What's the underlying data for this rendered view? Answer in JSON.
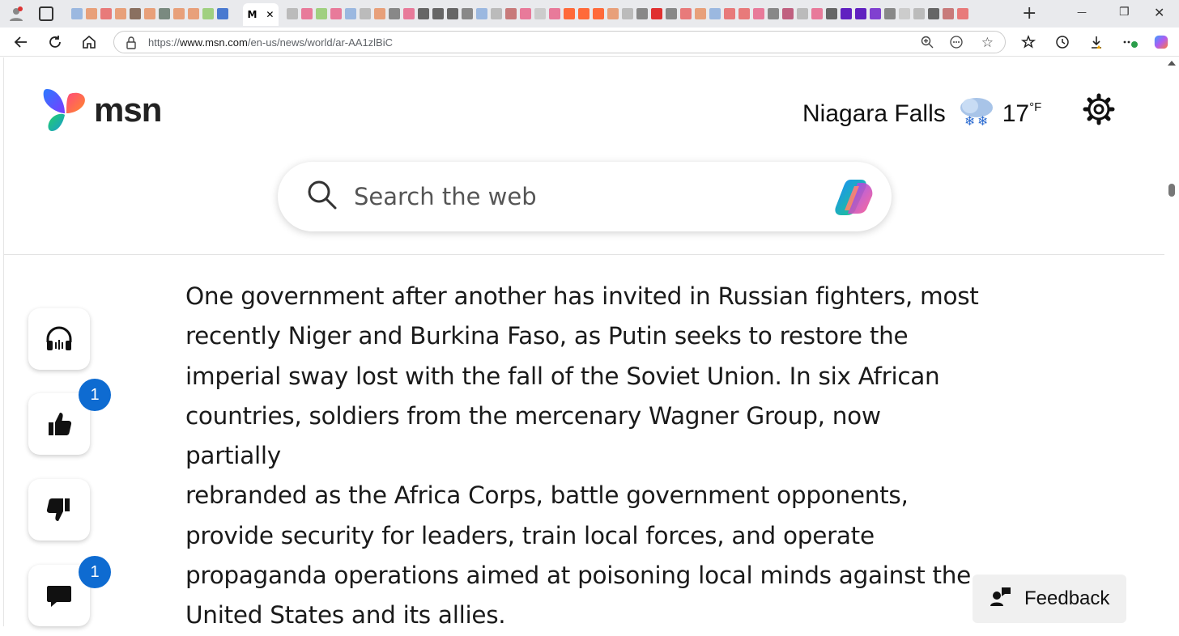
{
  "browser": {
    "url": "https://www.msn.com/en-us/news/world/ar-AA1zlBiC",
    "url_prefix": "https://",
    "url_host": "www.msn.com",
    "url_path": "/en-us/news/world/ar-AA1zlBiC",
    "tab_close": "✕",
    "new_tab": "+",
    "minimize": "—",
    "restore": "❐"
  },
  "header": {
    "logo_text": "msn",
    "city": "Niagara Falls",
    "temperature": "17",
    "temp_unit": "°F"
  },
  "search": {
    "placeholder": "Search the web"
  },
  "sidebar": {
    "like_count": "1",
    "comment_count": "1"
  },
  "article": {
    "line1": "One government after another has invited in Russian fighters, most",
    "line2": "recently Niger and Burkina Faso, as Putin seeks to restore the",
    "line3": "imperial sway lost with the fall of the Soviet Union. In six African",
    "line4": "countries, soldiers from the mercenary Wagner Group, now partially",
    "line5": "rebranded as the Africa Corps, battle government opponents,",
    "line6": "provide security for leaders, train local forces, and operate",
    "line7": "propaganda operations aimed at poisoning local minds against the",
    "line8": "United States and its allies."
  },
  "feedback": {
    "label": "Feedback"
  },
  "colors": {
    "badge": "#0e6bd1",
    "tabstrip": "#e9eaed"
  }
}
